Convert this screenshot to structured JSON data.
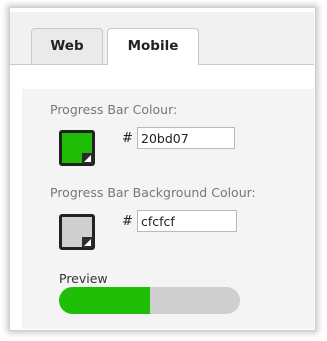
{
  "tabs": [
    {
      "label": "Web",
      "active": false
    },
    {
      "label": "Mobile",
      "active": true
    }
  ],
  "progress_bar_colour": {
    "label": "Progress Bar Colour:",
    "hash": "#",
    "value": "20bd07",
    "color": "#20bd07",
    "icon": "color-picker-swatch"
  },
  "progress_bar_background_colour": {
    "label": "Progress Bar Background Colour:",
    "hash": "#",
    "value": "cfcfcf",
    "color": "#cfcfcf",
    "icon": "color-picker-swatch"
  },
  "preview": {
    "label": "Preview",
    "progress_fraction": 0.5,
    "fill_color": "#20bd07",
    "track_color": "#cfcfcf"
  }
}
